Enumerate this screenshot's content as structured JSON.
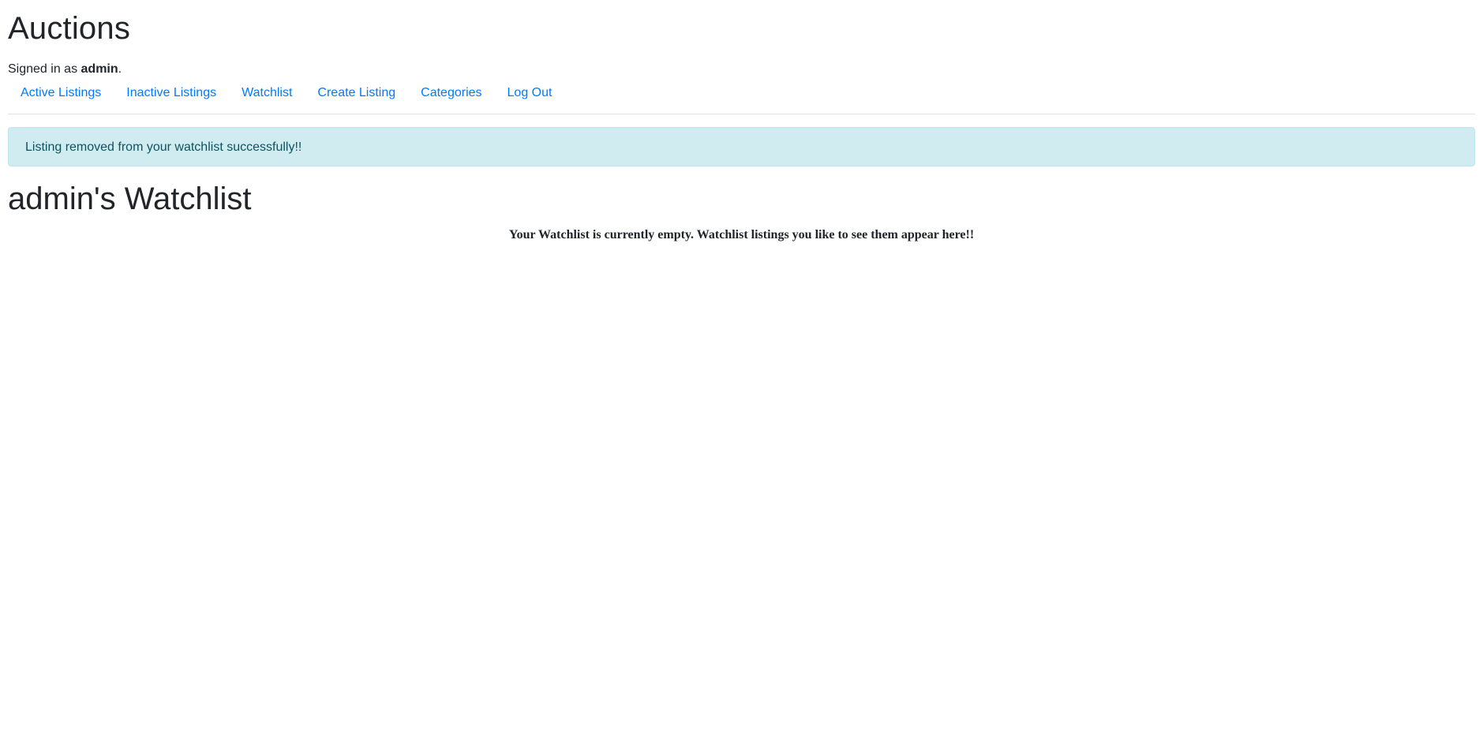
{
  "header": {
    "site_title": "Auctions",
    "signed_in_prefix": "Signed in as ",
    "username": "admin",
    "signed_in_suffix": "."
  },
  "nav": {
    "items": [
      {
        "label": "Active Listings"
      },
      {
        "label": "Inactive Listings"
      },
      {
        "label": "Watchlist"
      },
      {
        "label": "Create Listing"
      },
      {
        "label": "Categories"
      },
      {
        "label": "Log Out"
      }
    ]
  },
  "alert": {
    "message": "Listing removed from your watchlist successfully!!"
  },
  "main": {
    "title": "admin's Watchlist",
    "empty_message": "Your Watchlist is currently empty. Watchlist listings you like to see them appear here!!"
  },
  "colors": {
    "link": "#007bff",
    "alert_bg": "#d1ecf1",
    "alert_text": "#0c5460",
    "text": "#212529"
  }
}
